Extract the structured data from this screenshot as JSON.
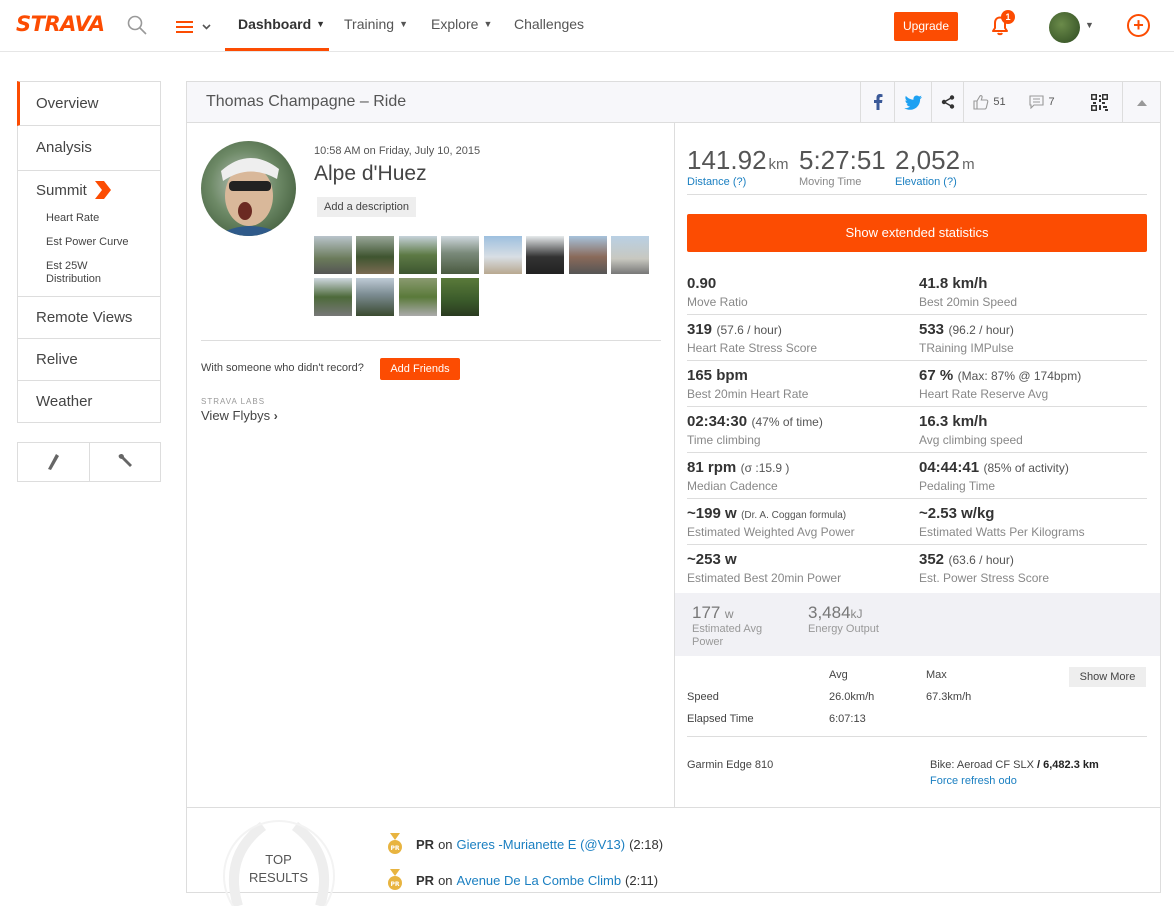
{
  "nav": {
    "logo": "STRAVA",
    "items": [
      {
        "label": "Dashboard"
      },
      {
        "label": "Training"
      },
      {
        "label": "Explore"
      },
      {
        "label": "Challenges"
      }
    ],
    "upgrade": "Upgrade",
    "notifications": "1"
  },
  "sidebar": {
    "items": [
      "Overview",
      "Analysis"
    ],
    "summit": {
      "title": "Summit",
      "sub": [
        "Heart Rate",
        "Est Power Curve",
        "Est 25W Distribution"
      ]
    },
    "items2": [
      "Remote Views",
      "Relive",
      "Weather"
    ]
  },
  "header": {
    "title": "Thomas Champagne – Ride",
    "kudos": "51",
    "comments": "7"
  },
  "activity": {
    "time": "10:58 AM on Friday, July 10, 2015",
    "name": "Alpe d'Huez",
    "add_desc": "Add a description",
    "someone": "With someone who didn't record?",
    "add_friends": "Add Friends",
    "labs": "STRAVA LABS",
    "flybys": "View Flybys"
  },
  "stats": {
    "distance": {
      "value": "141.92",
      "unit": "km",
      "label": "Distance (?)"
    },
    "moving_time": {
      "value": "5:27:51",
      "label": "Moving Time"
    },
    "elevation": {
      "value": "2,052",
      "unit": "m",
      "label": "Elevation (?)"
    },
    "extended_btn": "Show extended statistics",
    "rows": [
      {
        "lv": "0.90",
        "lx": "",
        "ll": "Move Ratio",
        "rv": "41.8 km/h",
        "rx": "",
        "rl": "Best 20min Speed"
      },
      {
        "lv": "319",
        "lx": "(57.6 / hour)",
        "ll": "Heart Rate Stress Score",
        "rv": "533",
        "rx": "(96.2 / hour)",
        "rl": "TRaining IMPulse"
      },
      {
        "lv": "165 bpm",
        "lx": "",
        "ll": "Best 20min Heart Rate",
        "rv": "67 %",
        "rx": "(Max: 87% @ 174bpm)",
        "rl": "Heart Rate Reserve Avg"
      },
      {
        "lv": "02:34:30",
        "lx": "(47% of time)",
        "ll": "Time climbing",
        "rv": "16.3 km/h",
        "rx": "",
        "rl": "Avg climbing speed"
      },
      {
        "lv": "81 rpm",
        "lx": "(σ :15.9 )",
        "ll": "Median Cadence",
        "rv": "04:44:41",
        "rx": "(85% of activity)",
        "rl": "Pedaling Time"
      },
      {
        "lv": "~199 w",
        "lx": "(Dr. A. Coggan formula)",
        "ll": "Estimated Weighted Avg Power",
        "rv": "~2.53 w/kg",
        "rx": "",
        "rl": "Estimated Watts Per Kilograms"
      },
      {
        "lv": "~253 w",
        "lx": "",
        "ll": "Estimated Best 20min Power",
        "rv": "352",
        "rx": "(63.6 / hour)",
        "rl": "Est. Power Stress Score"
      }
    ],
    "power": {
      "value": "177",
      "unit": "w",
      "label": "Estimated Avg Power"
    },
    "energy": {
      "value": "3,484",
      "unit": "kJ",
      "label": "Energy Output"
    },
    "table": {
      "avg": "Avg",
      "max": "Max",
      "show_more": "Show More",
      "speed_label": "Speed",
      "speed_avg": "26.0km/h",
      "speed_max": "67.3km/h",
      "elapsed_label": "Elapsed Time",
      "elapsed_avg": "6:07:13"
    },
    "device": "Garmin Edge 810",
    "bike": "Bike: Aeroad CF SLX",
    "odo": "/ 6,482.3 km",
    "refresh": "Force refresh odo"
  },
  "results": {
    "title_1": "TOP",
    "title_2": "RESULTS",
    "items": [
      {
        "pr": "PR",
        "on": "on",
        "segment": "Gieres -Murianette E (@V13)",
        "time": "(2:18)"
      },
      {
        "pr": "PR",
        "on": "on",
        "segment": "Avenue De La Combe Climb",
        "time": "(2:11)"
      }
    ]
  },
  "colors": {
    "brand": "#fc4c02",
    "link": "#1a7fc1"
  }
}
